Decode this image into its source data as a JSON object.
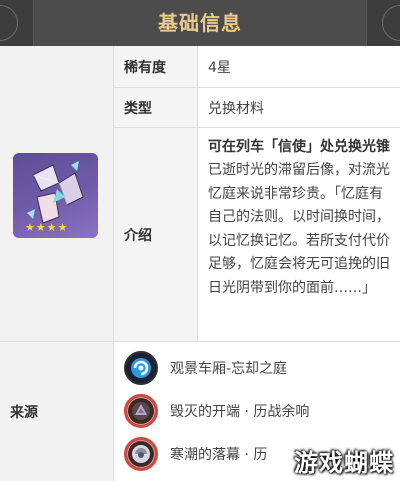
{
  "header": {
    "title": "基础信息"
  },
  "item": {
    "rarity_label": "稀有度",
    "rarity_value": "4星",
    "type_label": "类型",
    "type_value": "兑换材料",
    "intro_label": "介绍",
    "intro_title": "可在列车「信使」处兑换光锥",
    "intro_body": "已逝时光的滞留后像，对流光忆庭来说非常珍贵。「忆庭有自己的法则。以时间换时间，以记忆换记忆。若所支付代价足够，忆庭会将无可追挽的旧日光阴带到你的面前……」",
    "stars": "★★★★",
    "icon": "trace-of-memory-icon"
  },
  "sources": {
    "label": "来源",
    "items": [
      {
        "text": "观景车厢-忘却之庭",
        "icon": "forgotten-hall-icon"
      },
      {
        "text": "毁灭的开端 · 历战余响",
        "icon": "echo-of-war-icon"
      },
      {
        "text": "寒潮的落幕 · 历",
        "icon": "echo-of-war-icon"
      }
    ]
  },
  "watermark": "游戏蝴蝶",
  "colors": {
    "header_bg": "#4c4c4c",
    "title_gold": "#e8c98b",
    "echo_red": "#d2473f",
    "star_gold": "#ffd24a"
  }
}
